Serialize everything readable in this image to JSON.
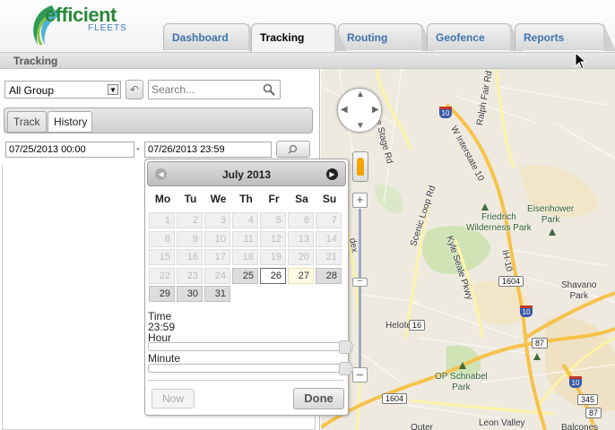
{
  "header": {
    "logo_word1": "efficient",
    "logo_word2": "FLEETS",
    "tabs": [
      {
        "label": "Dashboard"
      },
      {
        "label": "Tracking"
      },
      {
        "label": "Routing"
      },
      {
        "label": "Geofence"
      },
      {
        "label": "Reports"
      }
    ],
    "active_tab": "Tracking"
  },
  "subbar": {
    "title": "Tracking"
  },
  "left_panel": {
    "group_select": "All Group",
    "search_placeholder": "Search...",
    "subtabs": [
      {
        "label": "Track"
      },
      {
        "label": "History"
      }
    ],
    "active_subtab": "History",
    "date_from": "07/25/2013 00:00",
    "date_separator": "-",
    "date_to": "07/26/2013 23:59"
  },
  "calendar": {
    "title": "July 2013",
    "days_of_week": [
      "Mo",
      "Tu",
      "We",
      "Th",
      "Fr",
      "Sa",
      "Su"
    ],
    "weeks": [
      [
        "1",
        "2",
        "3",
        "4",
        "5",
        "6",
        "7"
      ],
      [
        "8",
        "9",
        "10",
        "11",
        "12",
        "13",
        "14"
      ],
      [
        "15",
        "16",
        "17",
        "18",
        "19",
        "20",
        "21"
      ],
      [
        "22",
        "23",
        "24",
        "25",
        "26",
        "27",
        "28"
      ],
      [
        "29",
        "30",
        "31",
        "",
        "",
        "",
        ""
      ]
    ],
    "selected_day": "26",
    "highlighted_day": "27",
    "time_label": "Time",
    "time_value": "23:59",
    "hour_label": "Hour",
    "minute_label": "Minute",
    "hour_level": 1.0,
    "minute_level": 1.0,
    "now_button": "Now",
    "done_button": "Done"
  },
  "map": {
    "road_labels": {
      "boerne_stage": "Boerne Stage Rd",
      "ralph_fair": "Ralph Fair Rd",
      "w_interstate": "W Interstate 10",
      "scenic_loop": "Scenic Loop Rd",
      "ih10": "IH-10",
      "kyle_seale": "Kyle Seale Pkwy",
      "dex": "dex"
    },
    "place_labels": {
      "friedrich": "Friedrich\nWilderness Park",
      "eisenhower": "Eisenhower\nPark",
      "shavano": "Shavano\nPark",
      "helotes": "Helotes",
      "op_schnabel": "OP Schnabel\nPark",
      "leon_valley": "Leon Valley",
      "balcones": "Balcones",
      "outer": "Outer"
    },
    "shields": {
      "i10_a": "10",
      "i10_b": "10",
      "i10_c": "10",
      "fm1604_a": "1604",
      "fm1604_b": "1604",
      "r16": "16",
      "r87": "87",
      "r345": "345",
      "r87b": "87"
    },
    "colors": {
      "land": "#eeeae0",
      "park": "#cfe3b5",
      "highway": "#f7c24a",
      "arterial": "#fdf3a6"
    }
  }
}
